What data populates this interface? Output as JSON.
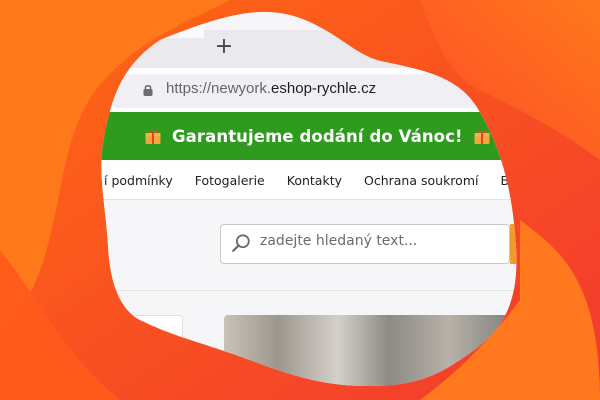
{
  "browser": {
    "new_tab_symbol": "+",
    "url": {
      "prefix": "https://newyork.",
      "host": "eshop-rychle.cz"
    }
  },
  "promo": {
    "text": "Garantujeme dodání do Vánoc!"
  },
  "nav": {
    "items": [
      {
        "label": "í podmínky"
      },
      {
        "label": "Fotogalerie"
      },
      {
        "label": "Kontakty"
      },
      {
        "label": "Ochrana soukromí"
      },
      {
        "label": "Blo"
      }
    ]
  },
  "search": {
    "placeholder": "zadejte hledaný text..."
  },
  "icons": {
    "gift": "gift-icon",
    "search": "search-icon",
    "chevron": "chevron-down-icon",
    "lock": "lock-icon"
  },
  "colors": {
    "bg_orange": "#ff6a12",
    "bg_red": "#f2392f",
    "promo_green": "#2e9b1f",
    "search_accent": "#f29b2a"
  }
}
